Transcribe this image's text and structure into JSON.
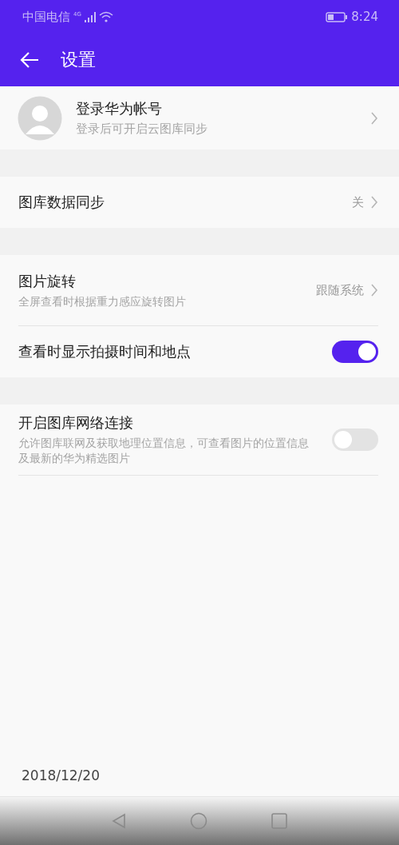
{
  "status_bar": {
    "carrier": "中国电信",
    "network": "4G",
    "time": "8:24"
  },
  "app_bar": {
    "title": "设置"
  },
  "account": {
    "title": "登录华为帐号",
    "subtitle": "登录后可开启云图库同步"
  },
  "sections": [
    {
      "items": [
        {
          "kind": "link",
          "title": "图库数据同步",
          "value": "关"
        }
      ]
    },
    {
      "items": [
        {
          "kind": "link",
          "title": "图片旋转",
          "subtitle": "全屏查看时根据重力感应旋转图片",
          "value": "跟随系统"
        },
        {
          "kind": "toggle",
          "title": "查看时显示拍摄时间和地点",
          "on": true
        }
      ]
    },
    {
      "items": [
        {
          "kind": "toggle",
          "title": "开启图库网络连接",
          "subtitle": "允许图库联网及获取地理位置信息，可查看图片的位置信息及最新的华为精选图片",
          "on": false
        }
      ]
    }
  ],
  "date_stamp": "2018/12/20"
}
